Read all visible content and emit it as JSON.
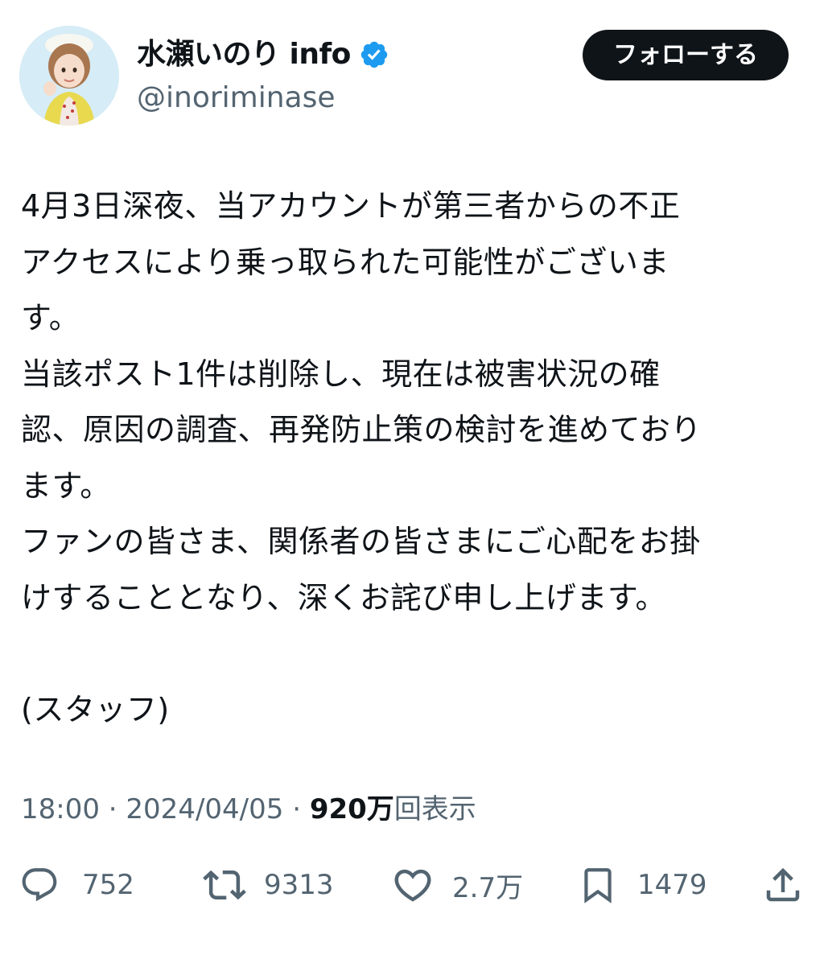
{
  "account": {
    "display_name": "水瀬いのり info",
    "handle": "@inoriminase",
    "verified_icon": "verified-badge-icon",
    "avatar_icon": "profile-avatar"
  },
  "follow_button": {
    "label": "フォローする"
  },
  "tweet": {
    "lines": [
      "4月3日深夜、当アカウントが第三者からの不正",
      "アクセスにより乗っ取られた可能性がございま",
      "す。",
      "当該ポスト1件は削除し、現在は被害状況の確",
      "認、原因の調査、再発防止策の検討を進めており",
      "ます。",
      "ファンの皆さま、関係者の皆さまにご心配をお掛",
      "けすることとなり、深くお詫び申し上げます。",
      "",
      "(スタッフ)"
    ]
  },
  "meta": {
    "time": "18:00",
    "separator": "·",
    "date": "2024/04/05",
    "views_count": "920万",
    "views_label": "回表示"
  },
  "actions": {
    "replies": {
      "icon": "reply-icon",
      "count": "752"
    },
    "reposts": {
      "icon": "repost-icon",
      "count": "9313"
    },
    "likes": {
      "icon": "heart-icon",
      "count": "2.7万"
    },
    "bookmarks": {
      "icon": "bookmark-icon",
      "count": "1479"
    },
    "share": {
      "icon": "share-icon"
    }
  },
  "colors": {
    "text_primary": "#0f1419",
    "text_secondary": "#536471",
    "verified_blue": "#1d9bf0",
    "button_bg": "#0f1419",
    "button_text": "#ffffff"
  }
}
